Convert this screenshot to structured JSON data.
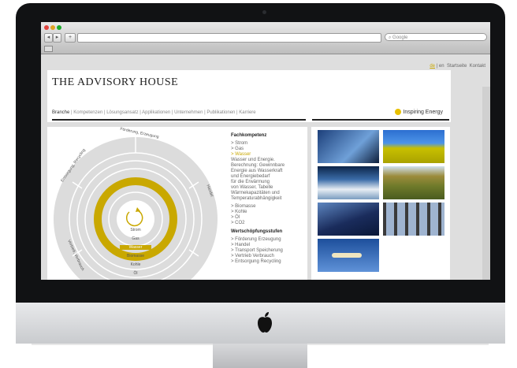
{
  "browser": {
    "search_placeholder": "Google",
    "nav": {
      "back": "◂",
      "forward": "▸",
      "add": "+"
    }
  },
  "site": {
    "top_links": {
      "lang_de": "de",
      "lang_en": "en",
      "startseite": "Startseite",
      "kontakt": "Kontakt"
    },
    "title": "THE ADVISORY HOUSE",
    "nav": [
      "Branche",
      "Kompetenzen",
      "Lösungsansatz",
      "Applikationen",
      "Unternehmen",
      "Publikationen",
      "Karriere"
    ],
    "inspiring": "Inspiring Energy",
    "accent_color": "#c9a800"
  },
  "wheel": {
    "outer_labels": [
      "Förderung, Erzeugung",
      "Handel",
      "Entsorgung, Recycling",
      "Vertrieb, Verbrauch"
    ],
    "ring_labels": [
      "Strom",
      "Gas",
      "Wasser",
      "Biomasse",
      "Kohle",
      "Öl"
    ],
    "active_ring": "Wasser"
  },
  "sidebar": {
    "fachkompetenz_heading": "Fachkompetenz",
    "fachkompetenz_items": [
      "> Strom",
      "> Gas",
      "> Wasser"
    ],
    "wasser_description": "Wasser und Energie.\nBerechnung: Gewinnbare\nEnergie aus Wasserkraft\nund Energiebedarf\nfür die Erwärmung\nvon Wasser, Tabelle\nWärmekapazitäten und\nTemperaturabhängigkeit",
    "fachkompetenz_more": [
      "> Biomasse",
      "> Kohle",
      "> Öl",
      "> CO2"
    ],
    "wertschoepfung_heading": "Wertschöpfungsstufen",
    "wertschoepfung_items": [
      "> Förderung Erzeugung",
      "> Handel",
      "> Transport Speicherung",
      "> Vertrieb Verbrauch",
      "> Entsorgung Recycling"
    ]
  },
  "gallery": {
    "images": [
      "power-line-tower",
      "gas-tank-dome",
      "water-spray",
      "corn-field",
      "mountain-landscape",
      "tree-trunks",
      "airplane-contrail"
    ]
  }
}
